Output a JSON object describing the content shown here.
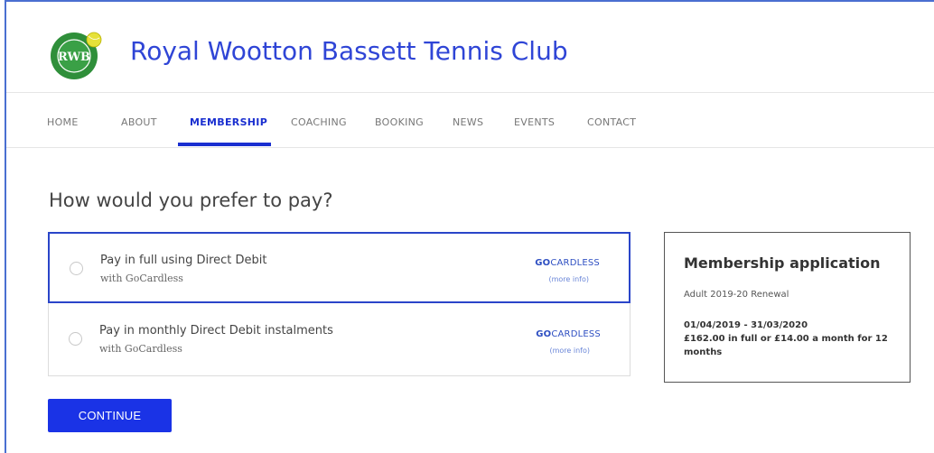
{
  "header": {
    "club_title": "Royal Wootton Bassett Tennis Club",
    "logo_text": "RWB",
    "logo_ring_top": "WOOTTON BASSETT",
    "logo_ring_bottom": "ROYAL TENNIS CLUB"
  },
  "nav": {
    "items": [
      {
        "label": "HOME"
      },
      {
        "label": "ABOUT"
      },
      {
        "label": "MEMBERSHIP",
        "active": true
      },
      {
        "label": "COACHING"
      },
      {
        "label": "BOOKING"
      },
      {
        "label": "NEWS"
      },
      {
        "label": "EVENTS"
      },
      {
        "label": "CONTACT"
      }
    ]
  },
  "payment": {
    "prompt": "How would you prefer to pay?",
    "options": [
      {
        "title": "Pay in full using Direct Debit",
        "subtitle": "with GoCardless",
        "brand_bold": "GO",
        "brand_rest": "CARDLESS",
        "more_info": "(more info)",
        "selected": true
      },
      {
        "title": "Pay in monthly Direct Debit instalments",
        "subtitle": "with GoCardless",
        "brand_bold": "GO",
        "brand_rest": "CARDLESS",
        "more_info": "(more info)",
        "selected": false
      }
    ],
    "continue_label": "CONTINUE"
  },
  "summary": {
    "title": "Membership application",
    "subtitle": "Adult 2019-20 Renewal",
    "period": "01/04/2019 - 31/03/2020",
    "price": "£162.00 in full or £14.00 a month for 12 months"
  },
  "colors": {
    "brand_blue": "#2f45d6",
    "nav_active": "#1a2fd0",
    "button_blue": "#1a33e6",
    "logo_green": "#2f8f3a",
    "tennis_ball": "#e6e13a"
  }
}
